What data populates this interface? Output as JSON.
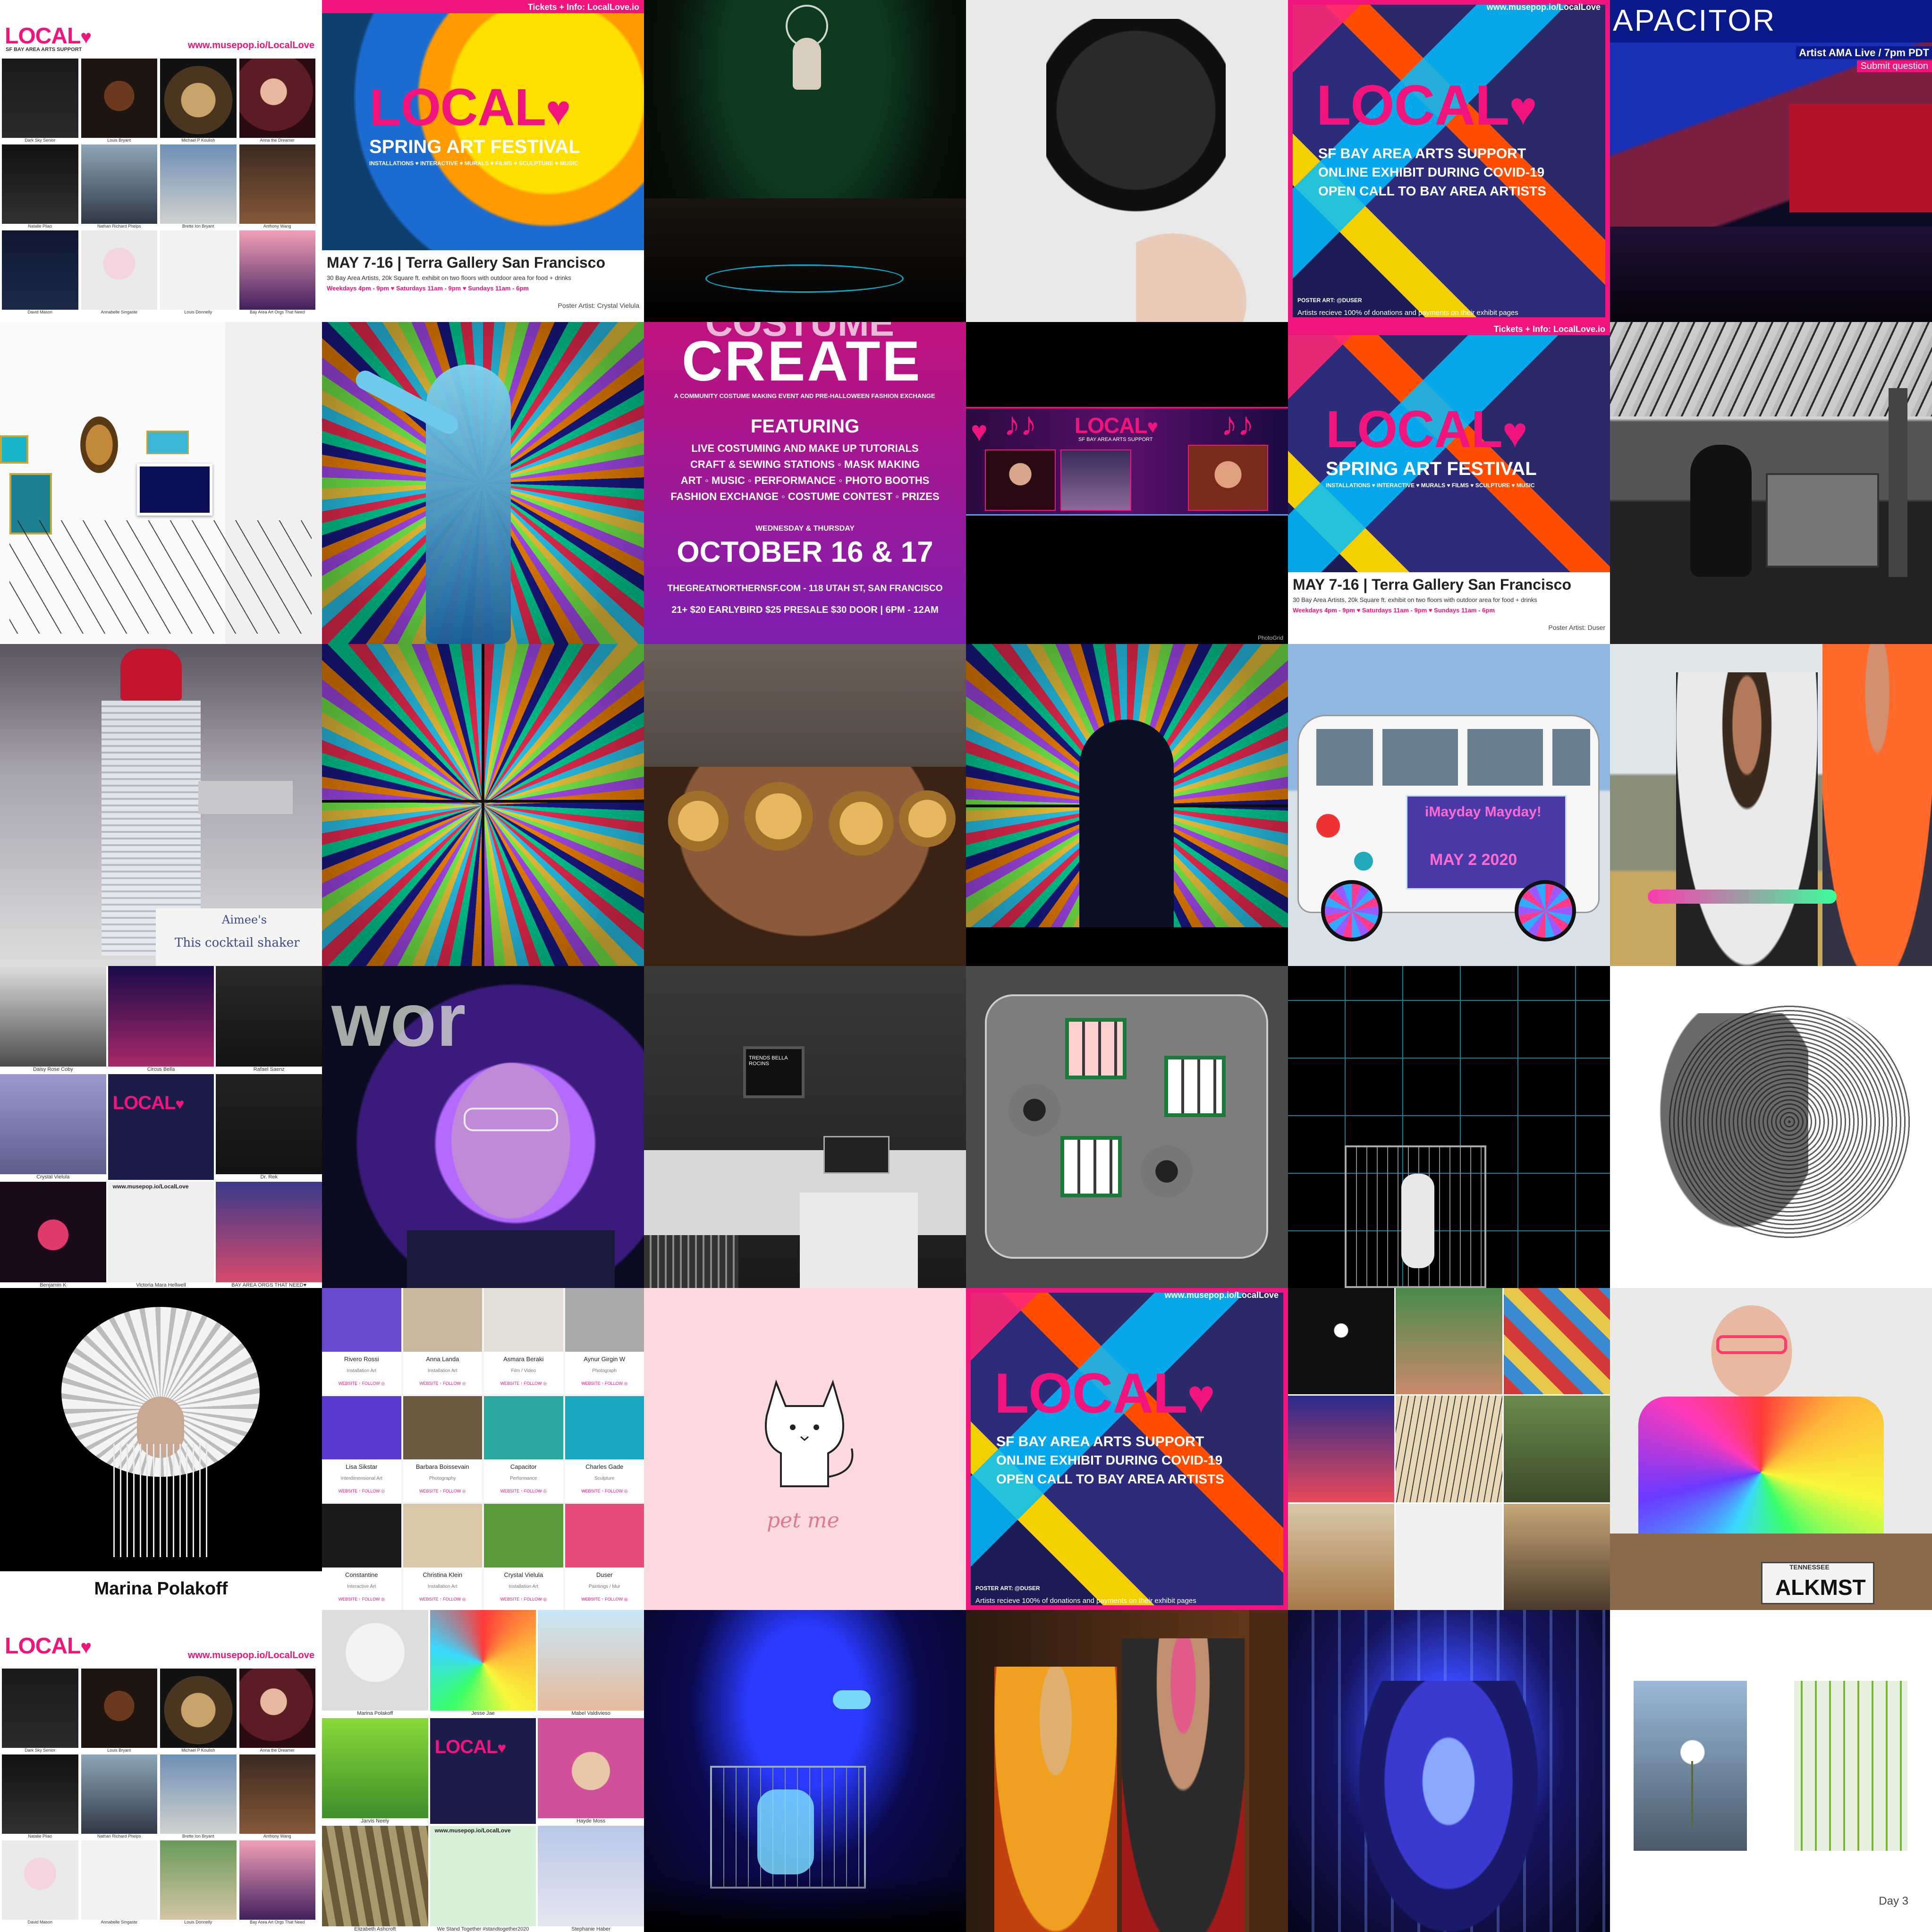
{
  "tiles": {
    "t1": {
      "logo": "LOCAL",
      "logo_sub": "SF BAY AREA ARTS SUPPORT",
      "url": "www.musepop.io/LocalLove",
      "captions": [
        "Dark Sky Senior",
        "Louis Bryant",
        "Michael P Koulish",
        "Anna the Dreamer",
        "Natalie Pliao",
        "Nathan Richard Phelps",
        "Brette Ion Bryant",
        "Anthony Wang",
        "David Mason",
        "Annabelle Singaste",
        "Louis Donnelly",
        "Bay Area Art Orgs That Need"
      ]
    },
    "t2": {
      "top": "Tickets + Info: LocalLove.io",
      "logo": "LOCAL",
      "title": "SPRING ART FESTIVAL",
      "cats": "INSTALLATIONS ♥ INTERACTIVE ♥ MURALS ♥ FILMS ♥ SCULPTURE ♥ MUSIC",
      "dates": "MAY 7-16 | Terra Gallery San Francisco",
      "detail": "30 Bay Area Artists, 20k Square ft. exhibit on two floors with outdoor area for food + drinks",
      "hours": "Weekdays 4pm - 9pm ♥ Saturdays 11am - 9pm ♥ Sundays 11am - 6pm",
      "poster": "Poster Artist: Crystal Vielula"
    },
    "t5": {
      "url": "www.musepop.io/LocalLove",
      "logo": "LOCAL",
      "line1": "SF BAY AREA ARTS SUPPORT",
      "line2": "ONLINE EXHIBIT DURING COVID-19",
      "line3": "OPEN CALL TO BAY AREA ARTISTS",
      "poster": "POSTER ART: @DUSER",
      "bottom": "Artists recieve 100% of donations and payments on their exhibit pages"
    },
    "t6": {
      "brand": "APACITOR",
      "ama": "Artist AMA Live / 7pm PDT",
      "submit": "Submit question"
    },
    "t9": {
      "header": "COSTUME",
      "title": "CREATE",
      "sub": "A COMMUNITY COSTUME MAKING EVENT AND PRE-HALLOWEEN FASHION EXCHANGE",
      "featuring": "FEATURING",
      "items": [
        "LIVE COSTUMING AND MAKE UP TUTORIALS",
        "CRAFT & SEWING STATIONS ◦ MASK MAKING",
        "ART ◦ MUSIC ◦ PERFORMANCE ◦ PHOTO BOOTHS",
        "FASHION EXCHANGE ◦ COSTUME CONTEST ◦ PRIZES"
      ],
      "days": "WEDNESDAY & THURSDAY",
      "date": "OCTOBER 16 & 17",
      "venue": "THEGREATNORTHERNSF.COM - 118 UTAH ST, SAN FRANCISCO",
      "price": "21+ $20 EARLYBIRD $25 PRESALE $30 DOOR | 6PM - 12AM"
    },
    "t10": {
      "logo": "LOCAL",
      "sub": "SF BAY AREA ARTS SUPPORT",
      "credit": "PhotoGrid"
    },
    "t11": {
      "top": "Tickets + Info: LocalLove.io",
      "logo": "LOCAL",
      "title": "SPRING ART FESTIVAL",
      "cats": "INSTALLATIONS ♥ INTERACTIVE ♥ MURALS ♥ FILMS ♥ SCULPTURE ♥ MUSIC",
      "dates": "MAY 7-16 | Terra Gallery San Francisco",
      "detail": "30 Bay Area Artists, 20k Square ft. exhibit on two floors with outdoor area for food + drinks",
      "hours": "Weekdays 4pm - 9pm ♥ Saturdays 11am - 9pm ♥ Sundays 11am - 6pm",
      "poster": "Poster Artist: Duser"
    },
    "t13": {
      "note1": "Aimee's",
      "note2": "This cocktail shaker"
    },
    "t17": {
      "sign": "iMayday Mayday!",
      "date": "MAY 2 2020"
    },
    "t19": {
      "captions": [
        "Daisy Rose Coby",
        "Circus Bella",
        "Rafael Saenz",
        "Crystal Vielula",
        "",
        "Dr. Rek",
        "Benjamin K",
        "Victoria Mara Hellwell",
        "BAY AREA ORGS THAT NEED♥"
      ],
      "logo": "LOCAL",
      "url": "www.musepop.io/LocalLove"
    },
    "t20": {
      "sign": "wor"
    },
    "t21": {
      "screen": "TRENDS BELLA ROCINS"
    },
    "t25": {
      "name": "Marina Polakoff"
    },
    "t26": {
      "names": [
        "Rivero Rossi",
        "Anna Landa",
        "Asmara Beraki",
        "Aynur Girgin W",
        "Lisa Sikstar",
        "Barbara Boissevain",
        "Capacitor",
        "Charles Gade",
        "Constantine",
        "Christina Klein",
        "Crystal Vielula",
        "Duser"
      ],
      "roles": [
        "Installation Art",
        "Installation Art",
        "Film / Video",
        "Photograph",
        "Interdimensional Art",
        "Photography",
        "Performance",
        "Sculpture",
        "Interactive Art",
        "Installation Art",
        "Installation Art",
        "Paintings / Mur"
      ],
      "link": "WEBSITE ↑ FOLLOW ◎"
    },
    "t27": {
      "text": "pet me"
    },
    "t28": {
      "url": "www.musepop.io/LocalLove",
      "logo": "LOCAL",
      "line1": "SF BAY AREA ARTS SUPPORT",
      "line2": "ONLINE EXHIBIT DURING COVID-19",
      "line3": "OPEN CALL TO BAY AREA ARTISTS",
      "poster": "POSTER ART: @DUSER",
      "bottom": "Artists recieve 100% of donations and payments on their exhibit pages"
    },
    "t30": {
      "plate": "ALKMST",
      "state": "TENNESSEE"
    },
    "t31": {
      "logo": "LOCAL",
      "url": "www.musepop.io/LocalLove",
      "captions": [
        "Dark Sky Senior",
        "Louis Bryant",
        "Michael P Koulish",
        "Anna the Dreamer",
        "Natalie Pliao",
        "Nathan Richard Phelps",
        "Brette Ion Bryant",
        "Anthony Wang",
        "David Mason",
        "Annabelle Singaste",
        "Louis Donnelly",
        "Bay Area Art Orgs That Need"
      ]
    },
    "t32": {
      "captions": [
        "Marina Polakoff",
        "Jesse Jae",
        "Mabel Valdivieso",
        "Jarvis Neely",
        "",
        "Hayde Moss",
        "Elizabeth Ashcroft",
        "We Stand Together #standtogether2020",
        "Stephanie Haber"
      ],
      "logo": "LOCAL",
      "url": "www.musepop.io/LocalLove"
    },
    "t36": {
      "label": "Day 3"
    }
  },
  "colors": {
    "brand_pink": "#f0147c",
    "poster_navy": "#1c1c4a",
    "night": "#0a0a14"
  }
}
